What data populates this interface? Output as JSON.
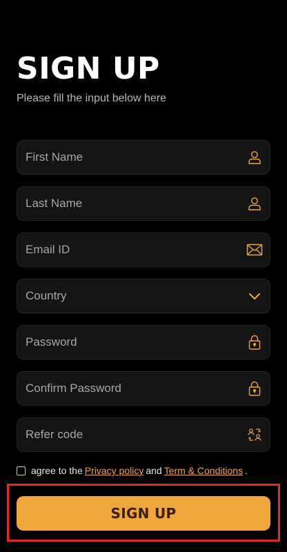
{
  "header": {
    "title": "SIGN UP",
    "subtitle": "Please fill the input below here"
  },
  "form": {
    "first_name": {
      "placeholder": "First Name",
      "icon": "user-icon"
    },
    "last_name": {
      "placeholder": "Last Name",
      "icon": "user-icon"
    },
    "email": {
      "placeholder": "Email ID",
      "icon": "mail-icon"
    },
    "country": {
      "value": "Country",
      "icon": "chevron-down-icon"
    },
    "password": {
      "placeholder": "Password",
      "icon": "lock-icon"
    },
    "confirm_password": {
      "placeholder": "Confirm Password",
      "icon": "lock-icon"
    },
    "refer_code": {
      "placeholder": "Refer code",
      "icon": "refer-users-icon"
    }
  },
  "terms": {
    "prefix": "agree to the",
    "privacy_link": "Privacy policy",
    "middle": "and",
    "terms_link": "Term & Conditions",
    "suffix": "."
  },
  "actions": {
    "signup_label": "SIGN UP"
  },
  "colors": {
    "accent": "#f0a63a",
    "background": "#000000",
    "field_background": "#141414",
    "highlight_border": "#e02b2b"
  }
}
